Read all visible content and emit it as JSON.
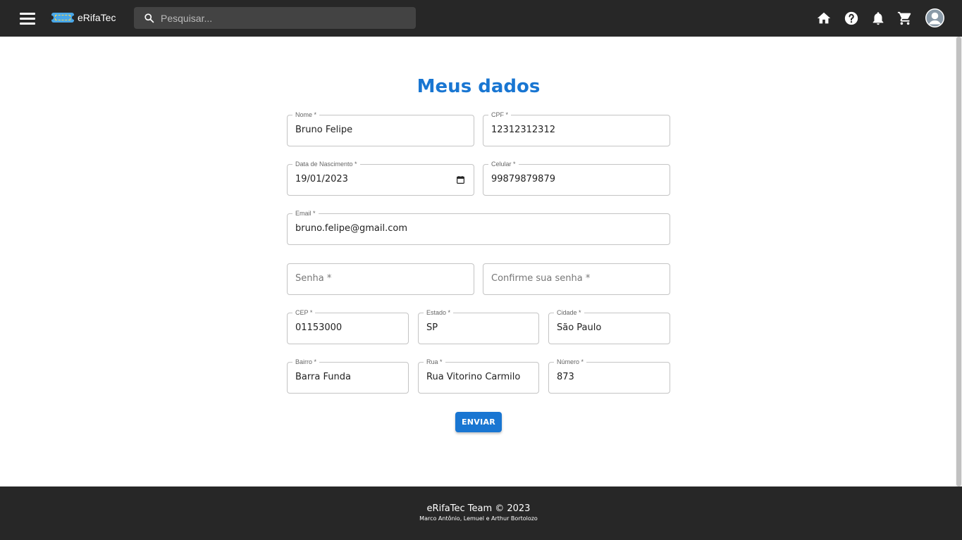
{
  "header": {
    "brand": "eRifaTec",
    "search_placeholder": "Pesquisar...",
    "icons": [
      "menu-icon",
      "home-icon",
      "help-icon",
      "bell-icon",
      "cart-icon",
      "account-icon"
    ]
  },
  "main": {
    "title": "Meus dados",
    "fields": {
      "nome": {
        "label": "Nome *",
        "value": "Bruno Felipe"
      },
      "cpf": {
        "label": "CPF *",
        "value": "12312312312"
      },
      "nascimento": {
        "label": "Data de Nascimento *",
        "value": "19/01/2023"
      },
      "celular": {
        "label": "Celular *",
        "value": "99879879879"
      },
      "email": {
        "label": "Email *",
        "value": "bruno.felipe@gmail.com"
      },
      "senha": {
        "placeholder": "Senha *"
      },
      "confirme": {
        "placeholder": "Confirme sua senha *"
      },
      "cep": {
        "label": "CEP *",
        "value": "01153000"
      },
      "estado": {
        "label": "Estado *",
        "value": "SP"
      },
      "cidade": {
        "label": "Cidade *",
        "value": "São Paulo"
      },
      "bairro": {
        "label": "Bairro *",
        "value": "Barra Funda"
      },
      "rua": {
        "label": "Rua *",
        "value": "Rua Vitorino Carmilo"
      },
      "numero": {
        "label": "Número *",
        "value": "873"
      }
    },
    "submit_label": "ENVIAR"
  },
  "footer": {
    "line1": "eRifaTec Team © 2023",
    "line2": "Marco Antônio, Lemuel e Arthur Bortolozo"
  },
  "colors": {
    "primary": "#1976d2",
    "appbar": "#272727",
    "search_bg": "#434343"
  }
}
